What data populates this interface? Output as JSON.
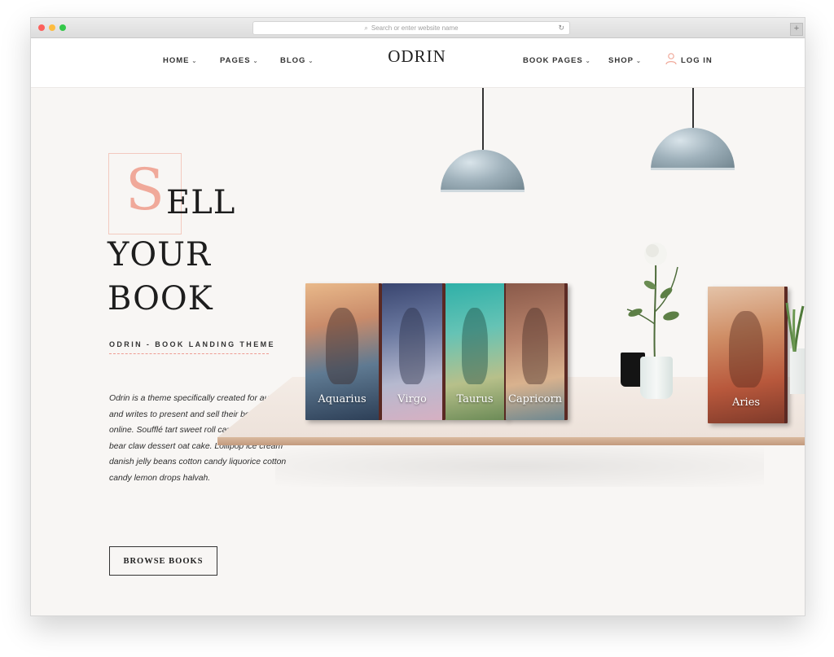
{
  "browser": {
    "address_placeholder": "Search or enter website name",
    "search_glyph": "⌕",
    "reload_glyph": "↻",
    "new_tab_glyph": "+"
  },
  "nav": {
    "left": [
      {
        "label": "HOME"
      },
      {
        "label": "PAGES"
      },
      {
        "label": "BLOG"
      }
    ],
    "logo": "ODRIN",
    "right": [
      {
        "label": "BOOK PAGES"
      },
      {
        "label": "SHOP"
      }
    ],
    "login_label": "LOG IN",
    "caret": "⌄"
  },
  "hero": {
    "cap_letter": "S",
    "line1_rest": "ELL",
    "line2": "YOUR",
    "line3": "BOOK",
    "subtitle": "ODRIN - BOOK LANDING THEME",
    "description": "Odrin is a theme specifically created for authors and writes to present and sell their books online. Soufflé tart sweet roll carrot cake icing bear claw dessert oat cake. Lollipop ice cream danish jelly beans cotton candy liquorice cotton candy lemon drops halvah.",
    "button_label": "BROWSE BOOKS"
  },
  "books": [
    {
      "title": "Aquarius"
    },
    {
      "title": "Virgo"
    },
    {
      "title": "Taurus"
    },
    {
      "title": "Capricorn"
    },
    {
      "title": "Aries"
    }
  ],
  "colors": {
    "accent": "#f0a99a",
    "text": "#1d1d1d",
    "background": "#f8f6f4"
  }
}
